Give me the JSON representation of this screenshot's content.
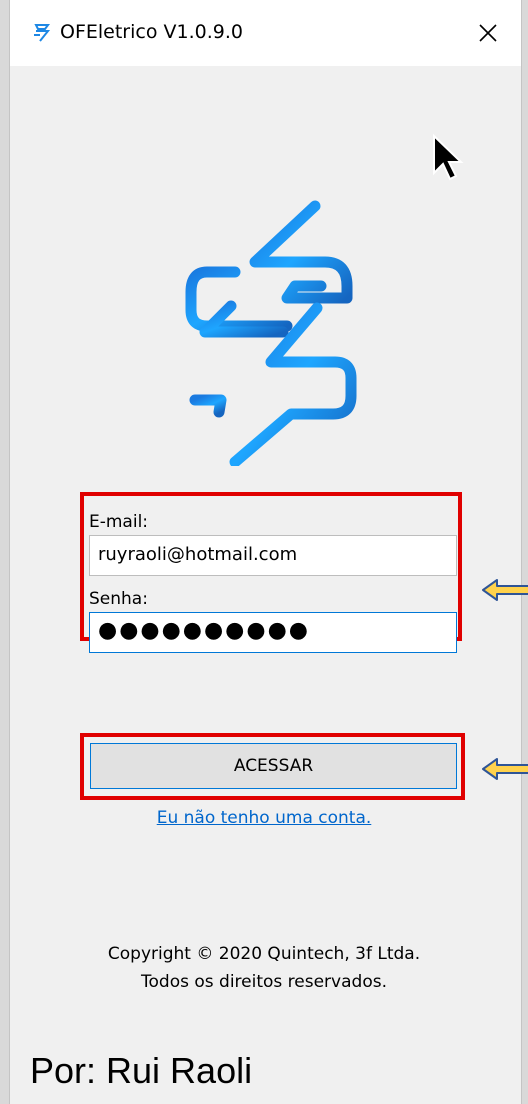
{
  "window": {
    "title": "OFEletrico V1.0.9.0"
  },
  "login": {
    "email_label": "E-mail:",
    "email_value": "ruyraoli@hotmail.com",
    "password_label": "Senha:",
    "password_value": "●●●●●●●●●●"
  },
  "actions": {
    "submit_label": "ACESSAR",
    "no_account_link": "Eu não tenho uma conta."
  },
  "footer": {
    "copyright": "Copyright © 2020 Quintech, 3f Ltda.",
    "rights": "Todos os direitos reservados."
  },
  "overlay": {
    "author_caption": "Por: Rui Raoli"
  },
  "colors": {
    "highlight_red": "#e00000",
    "arrow_fill": "#ffd24d",
    "arrow_stroke": "#2f5597",
    "logo_blue": "#1e90ff"
  }
}
